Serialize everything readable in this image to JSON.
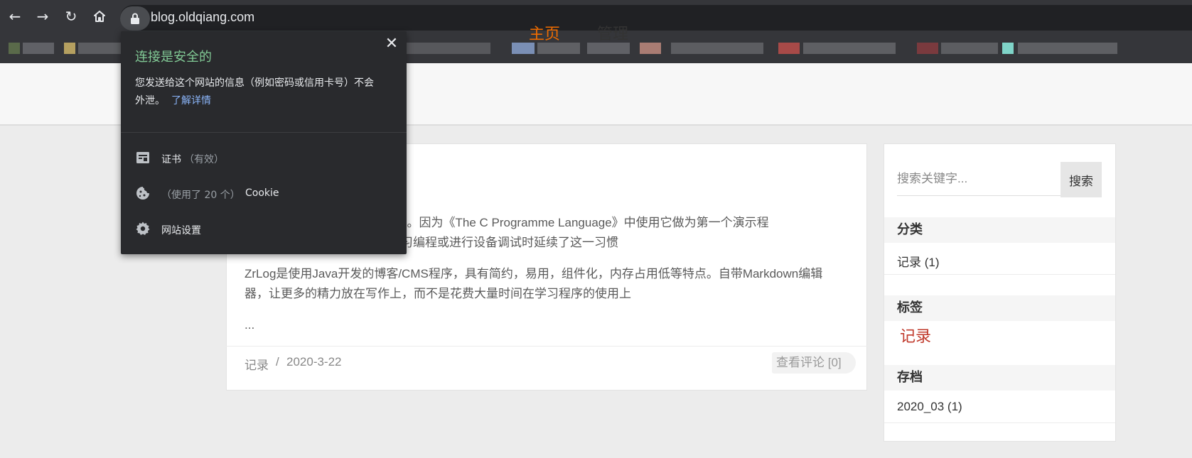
{
  "browser": {
    "url": "blog.oldqiang.com"
  },
  "site_nav": {
    "home": "主页",
    "admin": "管理"
  },
  "post": {
    "para1_line1": "界，你好』。因为《The C Programme Language》中使用它做为第一个演示程",
    "para1_line2": "序员在学习编程或进行设备调试时延续了这一习惯",
    "para2": "ZrLog是使用Java开发的博客/CMS程序，具有简约，易用，组件化，内存占用低等特点。自带Markdown编辑器，让更多的精力放在写作上，而不是花费大量时间在学习程序的使用上",
    "ellipsis": "...",
    "category": "记录",
    "separator": "/",
    "date": "2020-3-22",
    "comments": "查看评论 [0]"
  },
  "sidebar": {
    "search_placeholder": "搜索关键字...",
    "search_button": "搜索",
    "categories_title": "分类",
    "categories": [
      "记录 (1)"
    ],
    "tags_title": "标签",
    "tags": [
      "记录"
    ],
    "archive_title": "存档",
    "archives": [
      "2020_03 (1)"
    ]
  },
  "popup": {
    "title": "连接是安全的",
    "desc_line1": "您发送给这个网站的信息（例如密码或信用卡号）不会",
    "desc_line2": "外泄。",
    "learn_more": "了解详情",
    "certificate": "证书",
    "certificate_status": "（有效）",
    "cookies_count": "（使用了 20 个）",
    "cookies": "Cookie",
    "site_settings": "网站设置"
  },
  "colors": {
    "accent": "#ef6c00",
    "popup_title": "#81c995",
    "link": "#8ab4f8",
    "tag": "#c0392b"
  }
}
